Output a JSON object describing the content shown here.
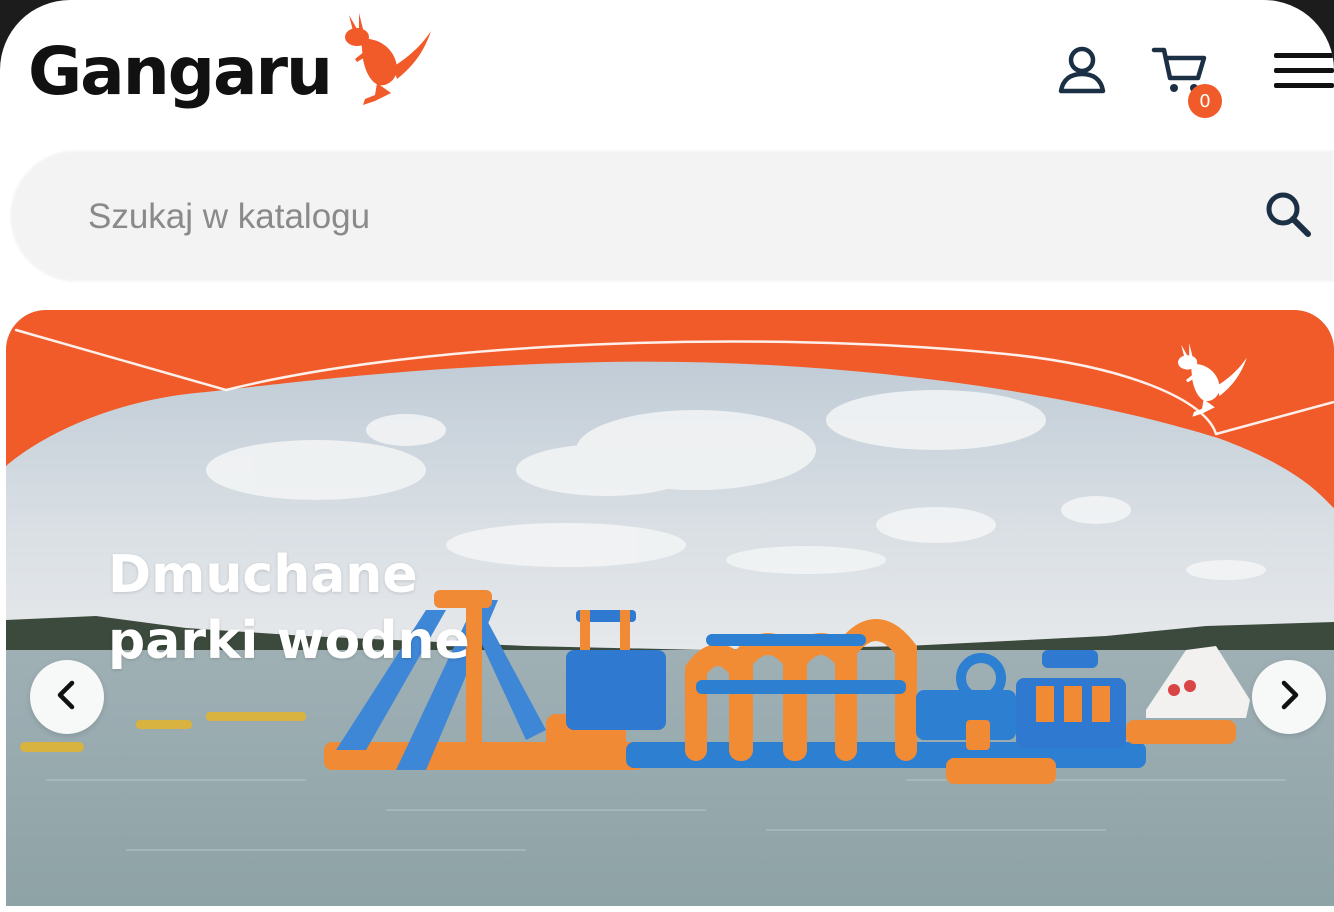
{
  "header": {
    "logo_text": "Gangaru",
    "cart_count": "0"
  },
  "search": {
    "placeholder": "Szukaj w katalogu"
  },
  "banner": {
    "heading": "Dmuchane parki wodne"
  },
  "colors": {
    "brand_orange": "#f15a29",
    "text_dark": "#111111",
    "icon_navy": "#1b2f45"
  },
  "icons": [
    "kangaroo-logo-icon",
    "user-icon",
    "cart-icon",
    "menu-icon",
    "search-icon",
    "chevron-left-icon",
    "chevron-right-icon"
  ]
}
